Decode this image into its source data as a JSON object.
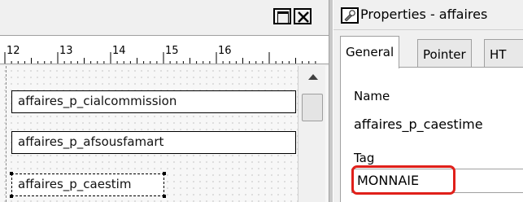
{
  "designer": {
    "ruler_numbers": [
      "12",
      "13",
      "14",
      "15",
      "16"
    ],
    "fields": [
      "affaires_p_cialcommission",
      "affaires_p_afsousfamart",
      "affaires_p_caestim"
    ]
  },
  "properties": {
    "title": "Properties - affaires",
    "tabs": [
      "General",
      "Pointer",
      "HT"
    ],
    "name_label": "Name",
    "name_value": "affaires_p_caestime",
    "tag_label": "Tag",
    "tag_value": "MONNAIE"
  },
  "colors": {
    "highlight": "#e0201a"
  }
}
